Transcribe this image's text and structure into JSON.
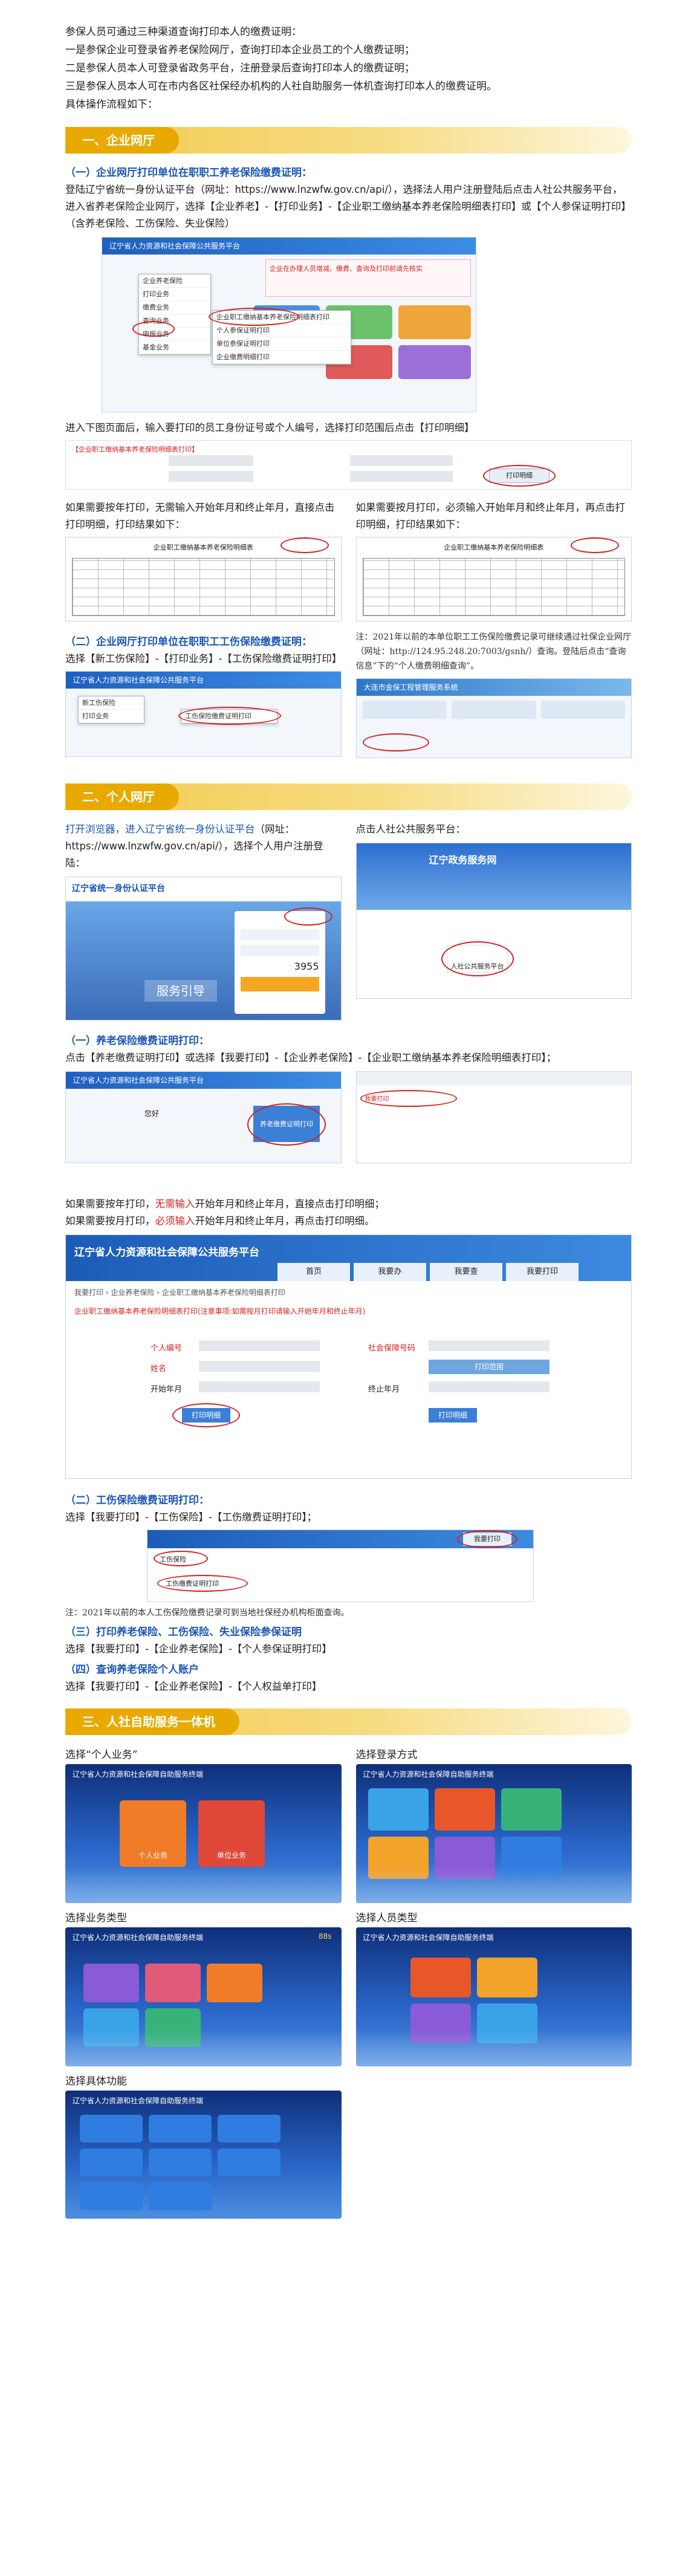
{
  "intro": {
    "lines": [
      "参保人员可通过三种渠道查询打印本人的缴费证明：",
      "一是参保企业可登录省养老保险网厅，查询打印本企业员工的个人缴费证明；",
      "二是参保人员本人可登录省政务平台，注册登录后查询打印本人的缴费证明；",
      "三是参保人员本人可在市内各区社保经办机构的人社自助服务一体机查询打印本人的缴费证明。",
      "具体操作流程如下："
    ]
  },
  "section1": {
    "title": "一、企业网厅",
    "sub1": {
      "heading": "（一）企业网厅打印单位在职职工养老保险缴费证明：",
      "text": "登陆辽宁省统一身份认证平台（网址：https://www.lnzwfw.gov.cn/api/），选择法人用户注册登陆后点击人社公共服务平台，进入省养老保险企业网厅，选择【企业养老】-【打印业务】-【企业职工缴纳基本养老保险明细表打印】或【个人参保证明打印】（含养老保险、工伤保险、失业保险）",
      "shot_title": "辽宁省人力资源和社会保障公共服务平台",
      "notice": "企业在办理人员增减、缴费、查询及打印前请先核实",
      "menu": [
        "企业养老保险",
        "打印业务",
        "缴费业务",
        "查询业务",
        "申报业务",
        "基金业务"
      ],
      "submenu": [
        "企业职工缴纳基本养老保险明细表打印",
        "个人参保证明打印",
        "单位参保证明打印",
        "企业缴费明细打印"
      ],
      "after": "进入下图页面后，输入要打印的员工身份证号或个人编号，选择打印范围后点击【打印明细】",
      "form_tip": "【企业职工缴纳基本养老保险明细表打印】",
      "print_btn": "打印明细",
      "left_caption": "如果需要按年打印，无需输入开始年月和终止年月，直接点击打印明细，打印结果如下：",
      "right_caption": "如果需要按月打印，必须输入开始年月和终止年月，再点击打印明细，打印结果如下：",
      "table_title": "企业职工缴纳基本养老保险明细表"
    },
    "sub2": {
      "heading": "（二）企业网厅打印单位在职职工工伤保险缴费证明：",
      "text": "选择【新工伤保险】-【打印业务】-【工伤保险缴费证明打印】",
      "note": "注：2021年以前的本单位职工工伤保险缴费记录可继续通过社保企业网厅（网址：http://124.95.248.20:7003/gsnh/）查询。登陆后点击“查询信息”下的“个人缴费明细查询”。",
      "shot_title": "大连市金保工程管理服务系统",
      "menu": [
        "新工伤保险",
        "打印业务",
        "工伤保险缴费证明打印"
      ]
    }
  },
  "section2": {
    "title": "二、个人网厅",
    "left_text_blue": "打开浏览器，进入辽宁省统一身份认证平台",
    "left_text_rest": "（网址：https://www.lnzwfw.gov.cn/api/），选择个人用户注册登陆：",
    "right_text": "点击人社公共服务平台：",
    "auth_title": "辽宁省统一身份认证平台",
    "auth_banner": "服务引导",
    "captcha": "3955",
    "gov_title": "辽宁政务服务网",
    "gov_link": "人社公共服务平台",
    "sub1": {
      "heading": "（一）养老保险缴费证明打印：",
      "text": "点击【养老缴费证明打印】或选择【我要打印】-【企业养老保险】-【企业职工缴纳基本养老保险明细表打印】；",
      "welcome": "您好",
      "print_link": "养老缴费证明打印",
      "caption_a": "如果需要按年打印，",
      "caption_a_red": "无需输入",
      "caption_a_rest": "开始年月和终止年月，直接点击打印明细；",
      "caption_b": "如果需要按月打印，",
      "caption_b_red": "必须输入",
      "caption_b_rest": "开始年月和终止年月，再点击打印明细。",
      "portal_title": "辽宁省人力资源和社会保障公共服务平台",
      "portal_tabs": [
        "首页",
        "我要办",
        "我要查",
        "我要打印"
      ],
      "breadcrumb": "我要打印 › 企业养老保险 › 企业职工缴纳基本养老保险明细表打印",
      "warn": "企业职工缴纳基本养老保险明细表打印(注意事项:如需按月打印请输入开始年月和终止年月)",
      "label_id": "个人编号",
      "label_name": "姓名",
      "label_start": "开始年月",
      "label_end": "终止年月",
      "label_idcard": "社会保障号码",
      "label_range": "打印范围",
      "btn_print": "打印明细",
      "btn_print2": "打印明细"
    },
    "sub2": {
      "heading": "（二）工伤保险缴费证明打印：",
      "text": "选择【我要打印】-【工伤保险】-【工伤缴费证明打印】；",
      "item1": "工伤保险",
      "item2": "工伤缴费证明打印",
      "tab": "我要打印",
      "note": "注：2021年以前的本人工伤保险缴费记录可到当地社保经办机构柜面查询。"
    },
    "sub3": {
      "heading": "（三）打印养老保险、工伤保险、失业保险参保证明",
      "text": "选择【我要打印】-【企业养老保险】-【个人参保证明打印】"
    },
    "sub4": {
      "heading": "（四）查询养老保险个人账户",
      "text": "选择【我要打印】-【企业养老保险】-【个人权益单打印】"
    }
  },
  "section3": {
    "title": "三、人社自助服务一体机",
    "kiosk_header": "辽宁省人力资源和社会保障自助服务终端",
    "captions": [
      "选择“个人业务”",
      "选择登录方式",
      "选择业务类型",
      "选择人员类型",
      "选择具体功能"
    ],
    "k1_buttons": [
      "个人业务",
      "单位业务"
    ],
    "timer": "88s"
  },
  "colors": {
    "accent_blue": "#1b56b6",
    "section_gold": "#e8a900",
    "warn_red": "#d82020"
  }
}
